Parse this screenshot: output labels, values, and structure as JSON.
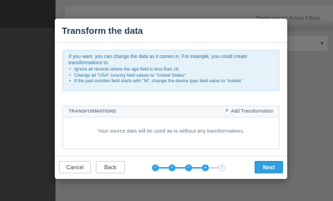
{
  "background": {
    "filter_status": "There are no Active Filters",
    "select_caret": "▾"
  },
  "modal": {
    "title": "Transform the data",
    "info": {
      "intro": "If you want, you can change the data as it comes in. For example, you could create transformations to:",
      "examples": [
        "Ignore all records where the age field is less than 18.",
        "Change all \"USA\" country field values to \"United States\"",
        "If the part-number field starts with \"M\", change the device type field value to \"mobile\""
      ]
    },
    "transformations": {
      "header": "TRANSFORMATIONS",
      "add_icon": "plus-icon",
      "add_glyph": "+",
      "add_label": "Add Transformation",
      "empty_message": "Your source data will be used as-is without any transformations."
    },
    "footer": {
      "cancel_label": "Cancel",
      "back_label": "Back",
      "next_label": "Next",
      "stepper": {
        "total_steps": 5,
        "current_step": 4,
        "check_glyph": "✓",
        "current_glyph": "+",
        "last_step_label": "5"
      }
    }
  },
  "colors": {
    "primary": "#2f9fe0",
    "title": "#2c3e50",
    "info_bg": "#e5f2fa",
    "info_text": "#2f6f9d"
  }
}
